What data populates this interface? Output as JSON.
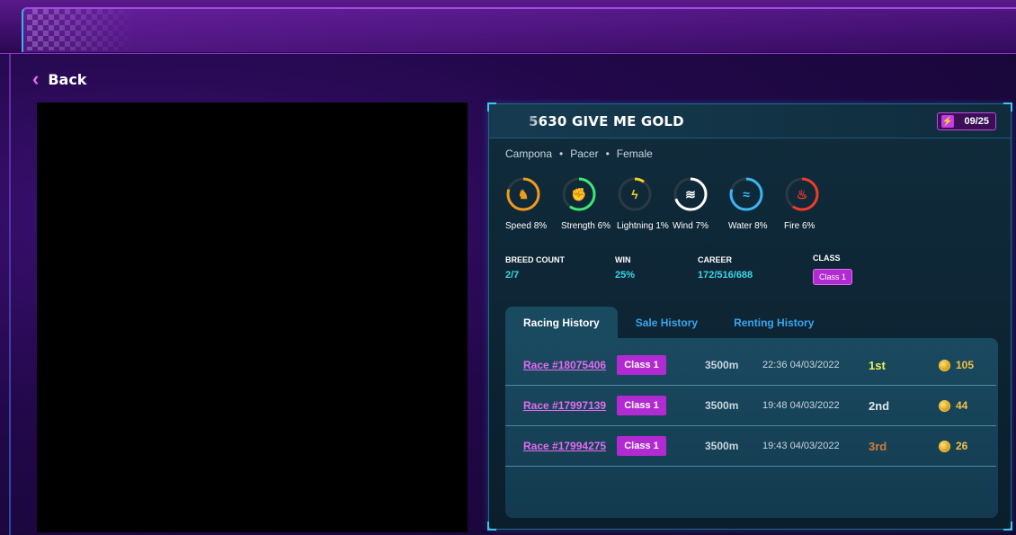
{
  "nav": {
    "back_label": "Back"
  },
  "horse": {
    "name": "5630 GIVE ME GOLD",
    "energy": "09/25",
    "breed": "Campona",
    "type": "Pacer",
    "gender": "Female"
  },
  "stats": [
    {
      "label": "Speed 8%",
      "icon": "horse-icon",
      "color": "#f29a1e",
      "value": 8
    },
    {
      "label": "Strength 6%",
      "icon": "fist-icon",
      "color": "#3ee872",
      "value": 6
    },
    {
      "label": "Lightning 1%",
      "icon": "lightning-icon",
      "color": "#f2d21e",
      "value": 1
    },
    {
      "label": "Wind 7%",
      "icon": "wind-icon",
      "color": "#ffffff",
      "value": 7
    },
    {
      "label": "Water 8%",
      "icon": "water-icon",
      "color": "#3ab6f2",
      "value": 8
    },
    {
      "label": "Fire 6%",
      "icon": "fire-icon",
      "color": "#f23a2a",
      "value": 6
    }
  ],
  "info": {
    "breed_count_label": "BREED COUNT",
    "breed_count": "2/7",
    "win_label": "WIN",
    "win": "25%",
    "career_label": "CAREER",
    "career": "172/516/688",
    "class_label": "CLASS",
    "class": "Class 1"
  },
  "tabs": [
    "Racing History",
    "Sale History",
    "Renting History"
  ],
  "history": [
    {
      "race": "Race #18075406",
      "class": "Class 1",
      "distance": "3500m",
      "time": "22:36 04/03/2022",
      "rank": "1st",
      "rank_color": "#e8f25a",
      "reward": "105"
    },
    {
      "race": "Race #17997139",
      "class": "Class 1",
      "distance": "3500m",
      "time": "19:48 04/03/2022",
      "rank": "2nd",
      "rank_color": "#dfe6ea",
      "reward": "44"
    },
    {
      "race": "Race #17994275",
      "class": "Class 1",
      "distance": "3500m",
      "time": "19:43 04/03/2022",
      "rank": "3rd",
      "rank_color": "#d27a3a",
      "reward": "26"
    }
  ]
}
